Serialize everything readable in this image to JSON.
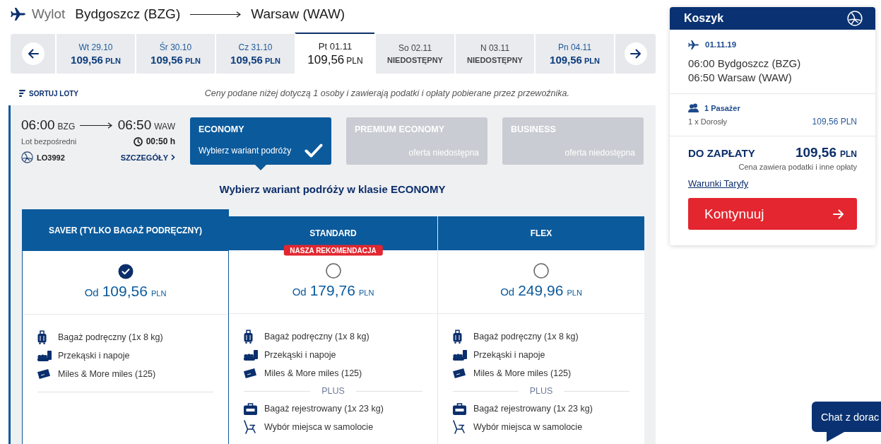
{
  "header": {
    "label": "Wylot",
    "origin": "Bydgoszcz (BZG)",
    "destination": "Warsaw (WAW)"
  },
  "date_strip": {
    "days": [
      {
        "kind": "price",
        "day": "Wt 29.10",
        "price": "109,56",
        "currency": "PLN",
        "selected": false
      },
      {
        "kind": "price",
        "day": "Śr 30.10",
        "price": "109,56",
        "currency": "PLN",
        "selected": false
      },
      {
        "kind": "price",
        "day": "Cz 31.10",
        "price": "109,56",
        "currency": "PLN",
        "selected": false
      },
      {
        "kind": "price",
        "day": "Pt 01.11",
        "price": "109,56",
        "currency": "PLN",
        "selected": true
      },
      {
        "kind": "unavailable",
        "day": "So 02.11",
        "status": "NIEDOSTĘPNY",
        "selected": false
      },
      {
        "kind": "unavailable",
        "day": "N 03.11",
        "status": "NIEDOSTĘPNY",
        "selected": false
      },
      {
        "kind": "price",
        "day": "Pn 04.11",
        "price": "109,56",
        "currency": "PLN",
        "selected": false
      }
    ]
  },
  "sort": {
    "label": "SORTUJ LOTY"
  },
  "notice": "Ceny podane niżej dotyczą 1 osoby i zawierają podatki i opłaty pobierane przez przewoźnika.",
  "flight": {
    "departure_time": "06:00",
    "departure_code": "BZG",
    "arrival_time": "06:50",
    "arrival_code": "WAW",
    "connection": "Lot bezpośredni",
    "duration": "00:50 h",
    "flight_number": "LO3992",
    "details_link": "SZCZEGÓŁY"
  },
  "cabins": [
    {
      "name": "ECONOMY",
      "note": "Wybierz wariant podróży",
      "selected": true,
      "available": true
    },
    {
      "name": "PREMIUM ECONOMY",
      "note": "oferta niedostępna",
      "selected": false,
      "available": false
    },
    {
      "name": "BUSINESS",
      "note": "oferta niedostępna",
      "selected": false,
      "available": false
    }
  ],
  "fare_heading": "Wybierz wariant podróży w klasie ECONOMY",
  "fares": [
    {
      "name": "SAVER (TYLKO BAGAŻ PODRĘCZNY)",
      "selected": true,
      "prefix": "Od",
      "price": "109,56",
      "currency": "PLN",
      "features": [
        {
          "kind": "cabin-bag",
          "text": "Bagaż podręczny (1x 8 kg)"
        },
        {
          "kind": "snacks",
          "text": "Przekąski i napoje"
        },
        {
          "kind": "miles",
          "text": "Miles & More miles (125)"
        }
      ]
    },
    {
      "name": "STANDARD",
      "selected": false,
      "badge": "NASZA REKOMENDACJA",
      "prefix": "Od",
      "price": "179,76",
      "currency": "PLN",
      "features": [
        {
          "kind": "cabin-bag",
          "text": "Bagaż podręczny (1x 8 kg)"
        },
        {
          "kind": "snacks",
          "text": "Przekąski i napoje"
        },
        {
          "kind": "miles",
          "text": "Miles & More miles (125)"
        }
      ],
      "plus": {
        "label": "PLUS",
        "features": [
          {
            "kind": "checked-bag",
            "text": "Bagaż rejestrowany (1x 23 kg)"
          },
          {
            "kind": "seat",
            "text": "Wybór miejsca w samolocie"
          }
        ]
      }
    },
    {
      "name": "FLEX",
      "selected": false,
      "prefix": "Od",
      "price": "249,96",
      "currency": "PLN",
      "features": [
        {
          "kind": "cabin-bag",
          "text": "Bagaż podręczny (1x 8 kg)"
        },
        {
          "kind": "snacks",
          "text": "Przekąski i napoje"
        },
        {
          "kind": "miles",
          "text": "Miles & More miles (125)"
        }
      ],
      "plus": {
        "label": "PLUS",
        "features": [
          {
            "kind": "checked-bag",
            "text": "Bagaż rejestrowany (1x 23 kg)"
          },
          {
            "kind": "seat",
            "text": "Wybór miejsca w samolocie"
          }
        ]
      }
    }
  ],
  "cart": {
    "title": "Koszyk",
    "date": "01.11.19",
    "segments": [
      "06:00 Bydgoszcz (BZG)",
      "06:50 Warsaw (WAW)"
    ],
    "passengers_label": "1 Pasażer",
    "passengers": [
      {
        "type": "1 x Dorosły",
        "amount": "109,56 PLN"
      }
    ],
    "total": {
      "label": "DO ZAPŁATY",
      "price": "109,56",
      "currency": "PLN",
      "note": "Cena zawiera podatki i inne opłaty"
    },
    "terms_link": "Warunki Taryfy",
    "continue_button": "Kontynuuj"
  },
  "chat": {
    "label": "Chat z dorac"
  }
}
